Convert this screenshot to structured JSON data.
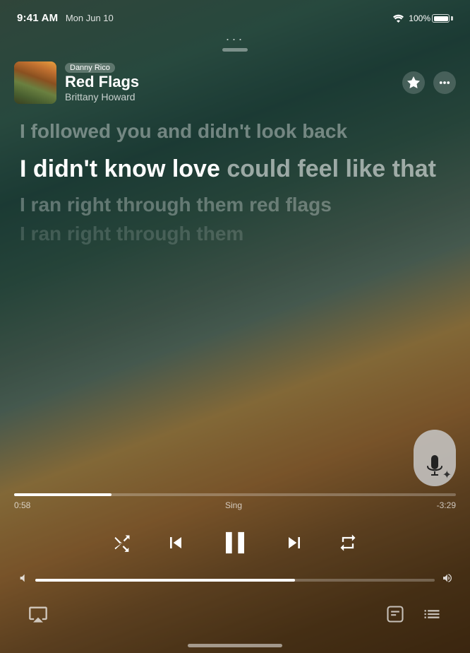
{
  "status_bar": {
    "time": "9:41 AM",
    "date": "Mon Jun 10",
    "wifi": "wifi-icon",
    "battery_pct": "100%"
  },
  "top_handle": {
    "dots": "···"
  },
  "now_playing": {
    "user_badge": "Danny Rico",
    "title": "Red Flags",
    "artist": "Brittany Howard",
    "star_icon": "star-icon",
    "more_icon": "more-icon"
  },
  "lyrics": {
    "line1": "I followed you and didn't look back",
    "line2_bold": "I didn't know love ",
    "line2_dim": "could feel like that",
    "line3": "I ran right through them red flags",
    "line4": "I ran right through them"
  },
  "progress": {
    "elapsed": "0:58",
    "label": "Sing",
    "remaining": "-3:29",
    "fill_pct": 22
  },
  "controls": {
    "shuffle_label": "shuffle",
    "prev_label": "previous",
    "play_pause_label": "pause",
    "next_label": "next",
    "repeat_label": "repeat"
  },
  "volume": {
    "fill_pct": 65
  },
  "bottom_bar": {
    "airplay_icon": "airplay-icon",
    "lyrics_icon": "lyrics-icon",
    "queue_icon": "queue-icon"
  }
}
